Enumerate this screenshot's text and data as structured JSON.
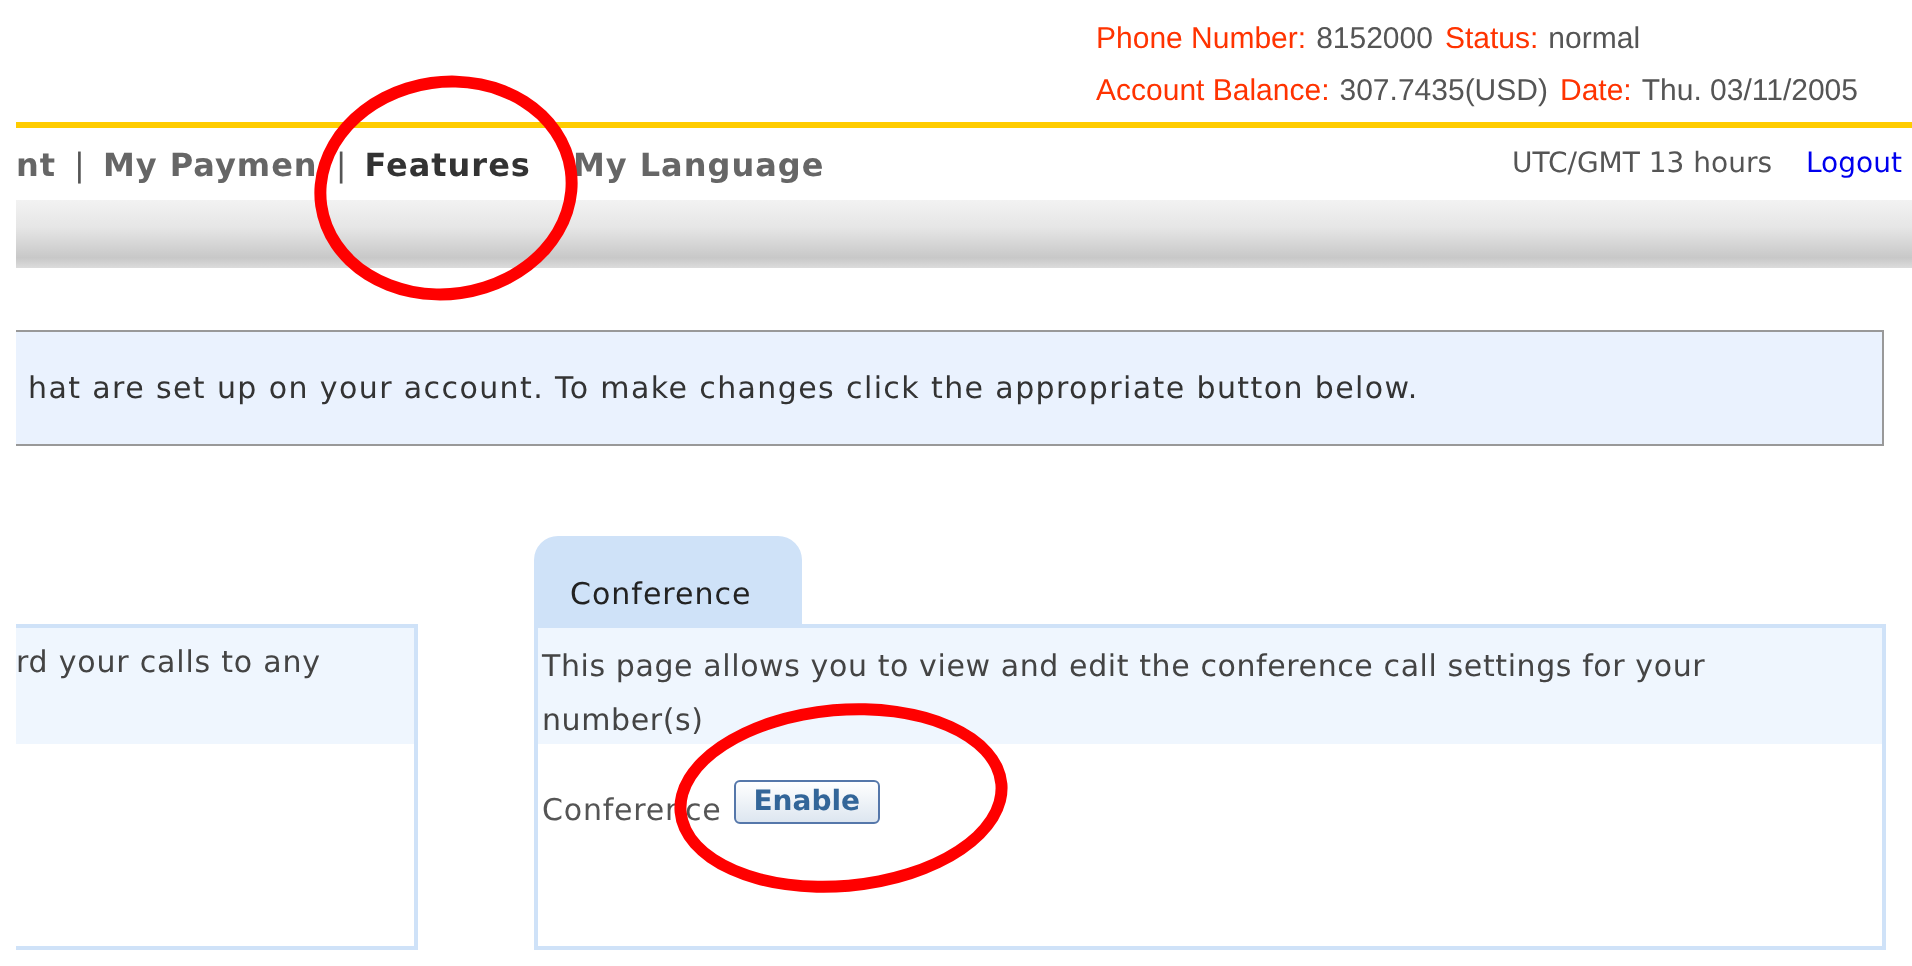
{
  "account_info": [
    [
      {
        "label": "Phone Number:",
        "value": "8152000"
      },
      {
        "label": "Status:",
        "value": "normal"
      }
    ],
    [
      {
        "label": "Account Balance:",
        "value": "307.7435(USD)"
      },
      {
        "label": "Date:",
        "value": "Thu. 03/11/2005"
      }
    ]
  ],
  "nav": [
    {
      "kind": "link",
      "label": "nt",
      "selected": false
    },
    {
      "kind": "separator",
      "label": "|"
    },
    {
      "kind": "link",
      "label": "My Paymen",
      "selected": false
    },
    {
      "kind": "separator",
      "label": "|"
    },
    {
      "kind": "link",
      "label": "Features",
      "selected": true
    },
    {
      "kind": "link",
      "label": "My Language",
      "selected": false
    }
  ],
  "timezone": "UTC/GMT 13 hours",
  "logout": "Logout",
  "info_message": "hat are set up on your account. To make changes click the appropriate button below.",
  "left_panel": {
    "description": "rd your calls to any"
  },
  "conference_panel": {
    "tab": "Conference",
    "description": "This page allows you to view and edit the conference call settings for your number(s)",
    "field_label": "Conference",
    "button": "Enable"
  },
  "annotations": [
    {
      "kind": "ellipse"
    },
    {
      "kind": "ellipse"
    }
  ]
}
